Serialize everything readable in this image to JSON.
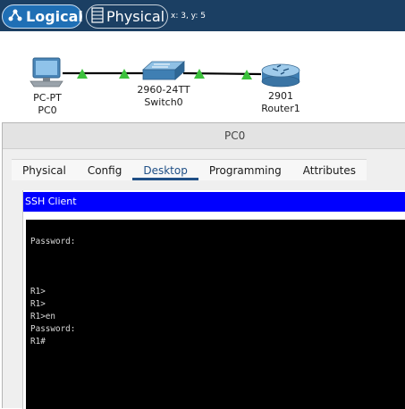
{
  "topbar": {
    "logical_label": "Logical",
    "physical_label": "Physical",
    "coords": "x: 3, y: 5"
  },
  "topology": {
    "devices": [
      {
        "name": "PC-PT",
        "label": "PC0",
        "icon": "pc-icon"
      },
      {
        "name": "2960-24TT",
        "label": "Switch0",
        "icon": "switch-icon"
      },
      {
        "name": "2901",
        "label": "Router1",
        "icon": "router-icon"
      }
    ],
    "link_color": "#000000",
    "link_status_color": "#3cc13c"
  },
  "window": {
    "title": "PC0",
    "tabs": [
      {
        "label": "Physical",
        "active": false
      },
      {
        "label": "Config",
        "active": false
      },
      {
        "label": "Desktop",
        "active": true
      },
      {
        "label": "Programming",
        "active": false
      },
      {
        "label": "Attributes",
        "active": false
      }
    ],
    "ssh_title": "SSH Client",
    "terminal_lines": [
      "",
      "Password:",
      "",
      "",
      "",
      "R1>",
      "R1>",
      "R1>en",
      "Password:",
      "R1#"
    ]
  },
  "colors": {
    "topbar": "#1b3f63",
    "logical_active": "#1f6fb5",
    "ssh_bar": "#0000ff",
    "terminal_bg": "#000000"
  }
}
